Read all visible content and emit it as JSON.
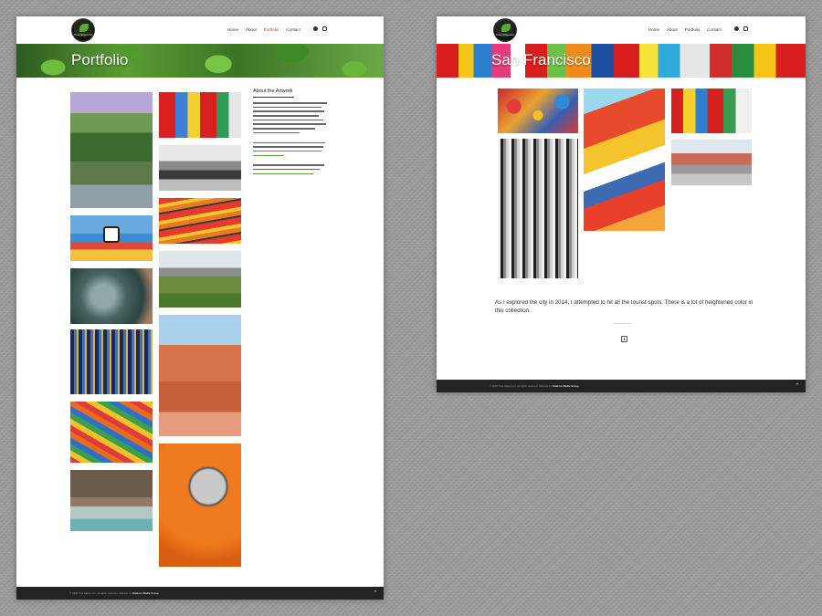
{
  "left_page": {
    "logo_text": "Tina Nelson Art",
    "menu": [
      "Home",
      "About",
      "Portfolio",
      "Contact"
    ],
    "active_menu": "Portfolio",
    "social_icons": [
      "facebook-icon",
      "instagram-icon"
    ],
    "hero_title": "Portfolio",
    "sidebar_heading": "About the Artwork",
    "footer_text": "© 2020 Tina Nelson Art. All rights reserved. Website by",
    "footer_link": "Outdoor Media Group",
    "colors": {
      "accent": "#c0392b",
      "footer_bg": "#232323",
      "link": "#5a9c36"
    }
  },
  "right_page": {
    "logo_text": "Tina Nelson Art",
    "menu": [
      "Home",
      "About",
      "Portfolio",
      "Contact"
    ],
    "social_icons": [
      "facebook-icon",
      "instagram-icon"
    ],
    "hero_title": "San Francisco",
    "description": "As I explored the city in 2014, I attempted to hit all the tourist spots. There is a lot of heightened color in this collection.",
    "footer_text": "© 2020 Tina Nelson Art. All rights reserved. Website by",
    "footer_link": "Outdoor Media Group"
  }
}
